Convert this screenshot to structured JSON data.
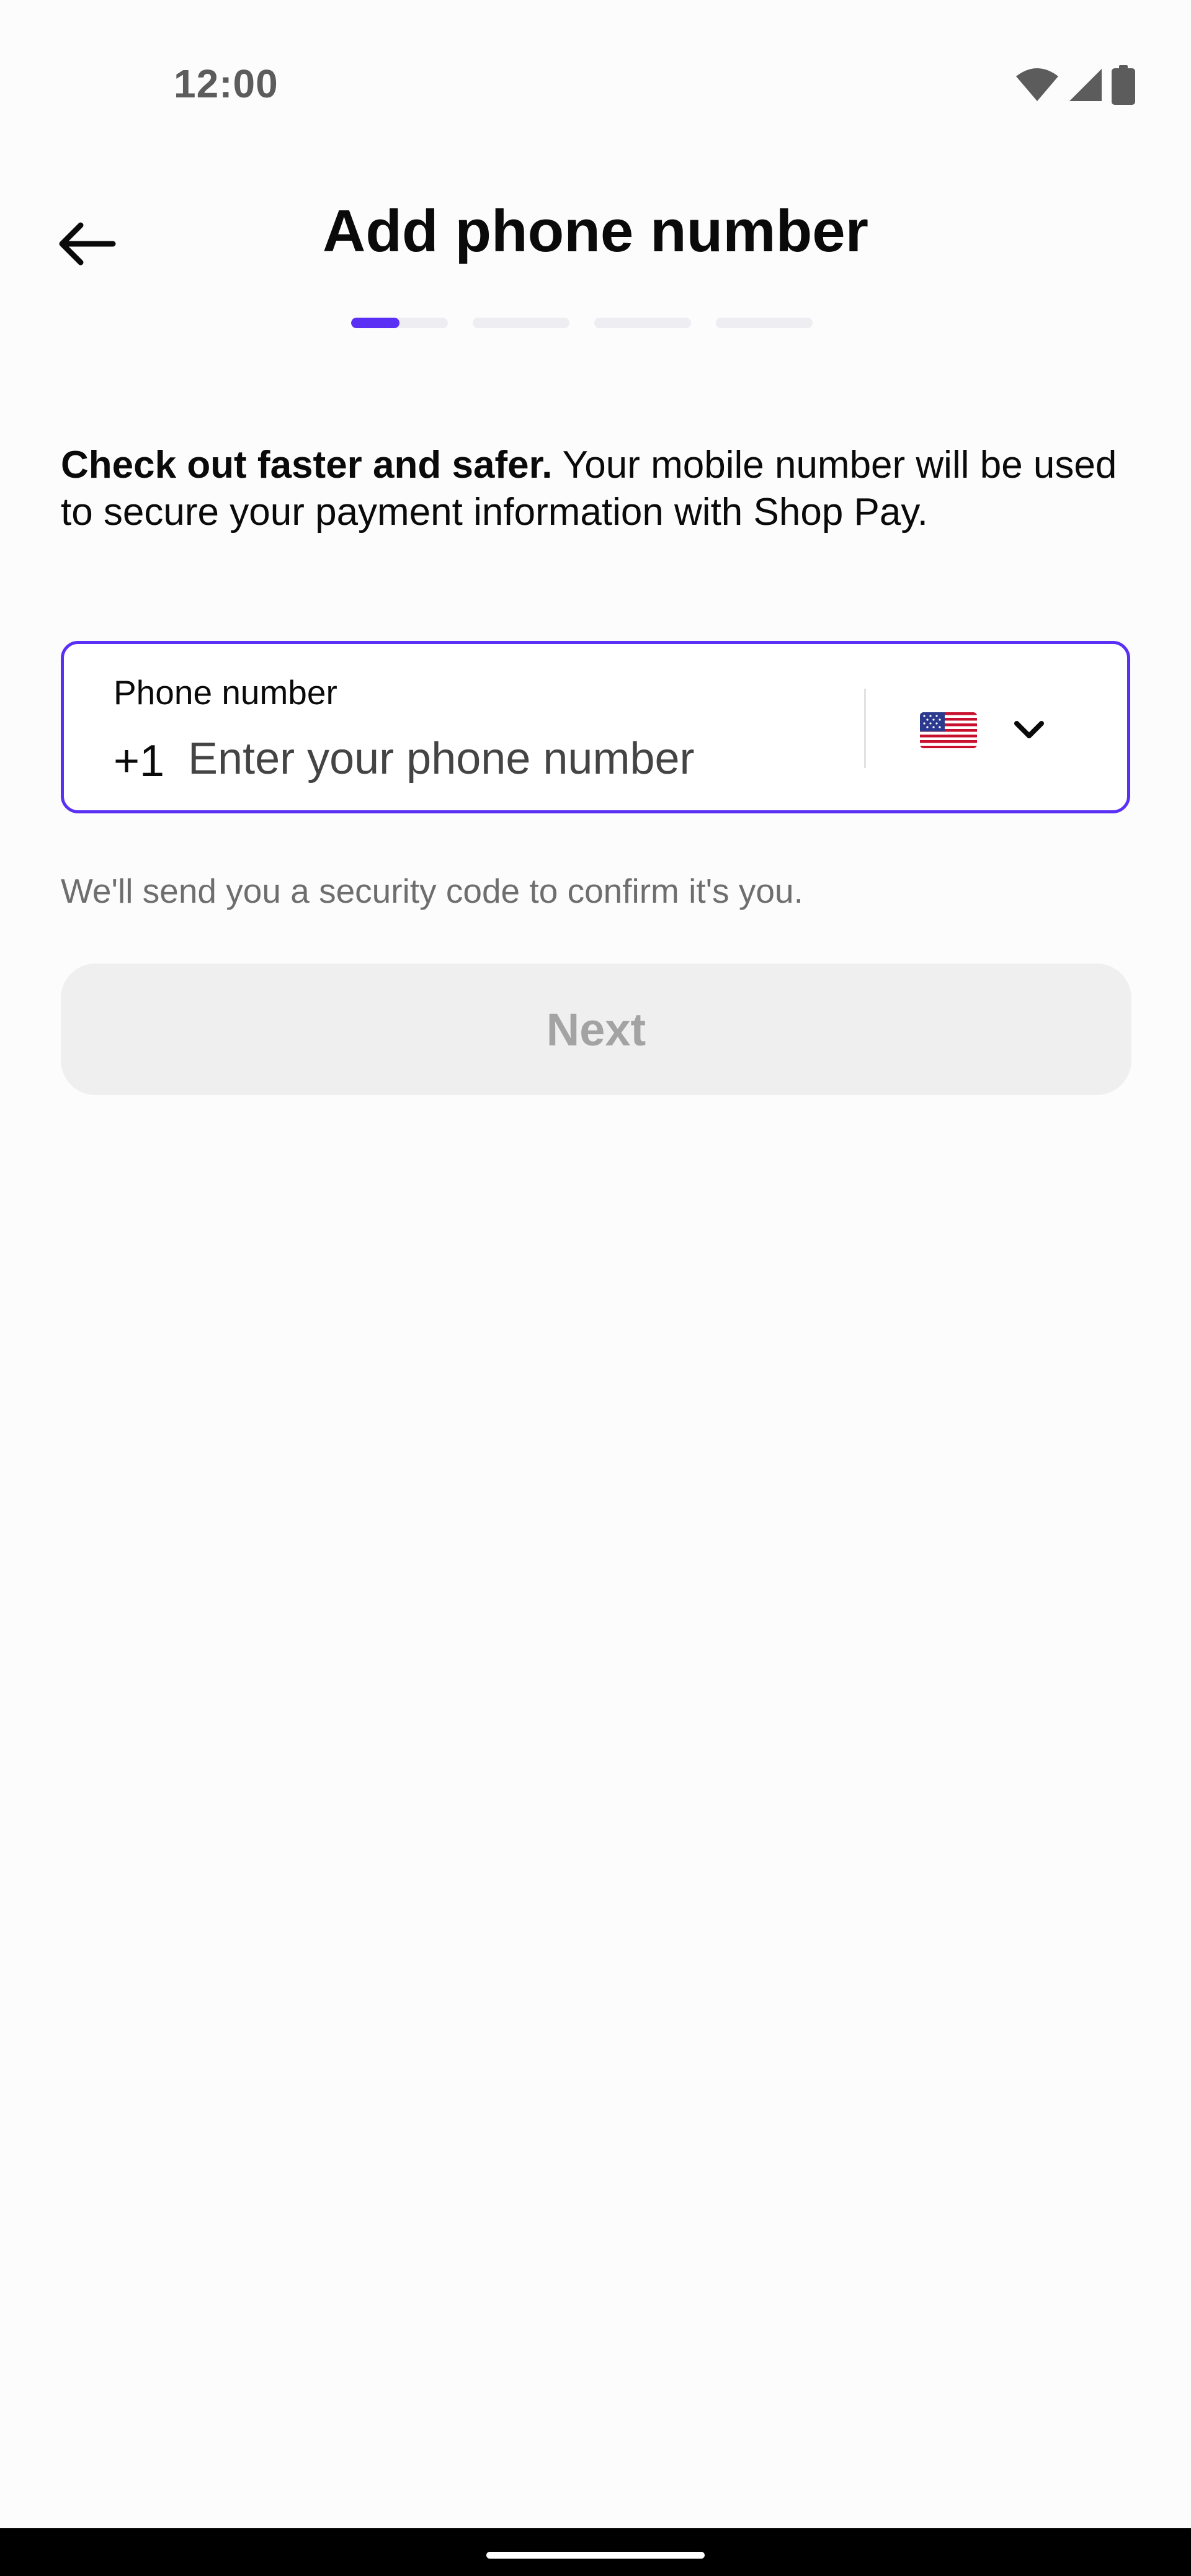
{
  "status_bar": {
    "time": "12:00",
    "icons": [
      "wifi-icon",
      "signal-icon",
      "battery-icon"
    ]
  },
  "header": {
    "title": "Add phone number",
    "back_icon": "arrow-left-icon"
  },
  "progress": {
    "total_steps": 4,
    "current_step": 1,
    "current_step_fraction": 0.5,
    "active_color": "#5a31f4",
    "inactive_color": "#ededf2"
  },
  "intro": {
    "bold_text": "Check out faster and safer.",
    "rest_text": " Your mobile number will be used to secure your payment information with Shop Pay."
  },
  "phone_field": {
    "label": "Phone number",
    "dial_code": "+1",
    "value": "",
    "placeholder": "Enter your phone number",
    "border_color": "#5a31f4",
    "country": {
      "flag_icon": "us-flag-icon",
      "chevron_icon": "chevron-down-icon"
    }
  },
  "helper_text": "We'll send you a security code to confirm it's you.",
  "next_button": {
    "label": "Next",
    "disabled": true
  }
}
